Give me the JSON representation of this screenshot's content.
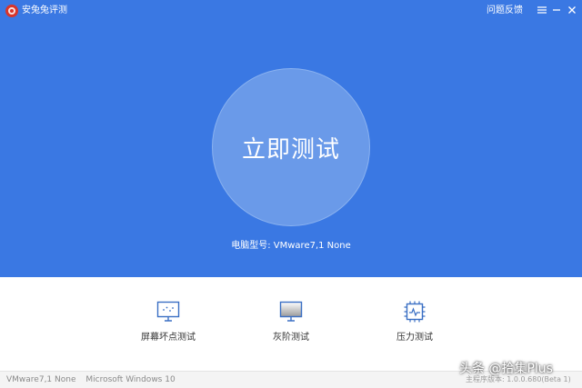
{
  "app": {
    "title": "安兔兔评测"
  },
  "titlebar": {
    "feedback_label": "问题反馈",
    "menu_icon": "menu-icon",
    "minimize_icon": "minimize-icon",
    "close_icon": "close-icon"
  },
  "main": {
    "start_label": "立即测试",
    "model_label": "电脑型号:",
    "model_value": "VMware7,1 None"
  },
  "tools": [
    {
      "label": "屏幕坏点测试",
      "icon": "monitor-dots-icon"
    },
    {
      "label": "灰阶测试",
      "icon": "monitor-grayscale-icon"
    },
    {
      "label": "压力测试",
      "icon": "cpu-pulse-icon"
    }
  ],
  "statusbar": {
    "model": "VMware7,1 None",
    "os": "Microsoft Windows 10",
    "version": "主程序版本: 1.0.0.680(Beta 1)"
  },
  "watermark": "头条 @拾集Plus",
  "colors": {
    "primary_blue": "#3a78e3",
    "circle_fill": "#6a9ae9",
    "icon_blue": "#3a6fc4"
  }
}
